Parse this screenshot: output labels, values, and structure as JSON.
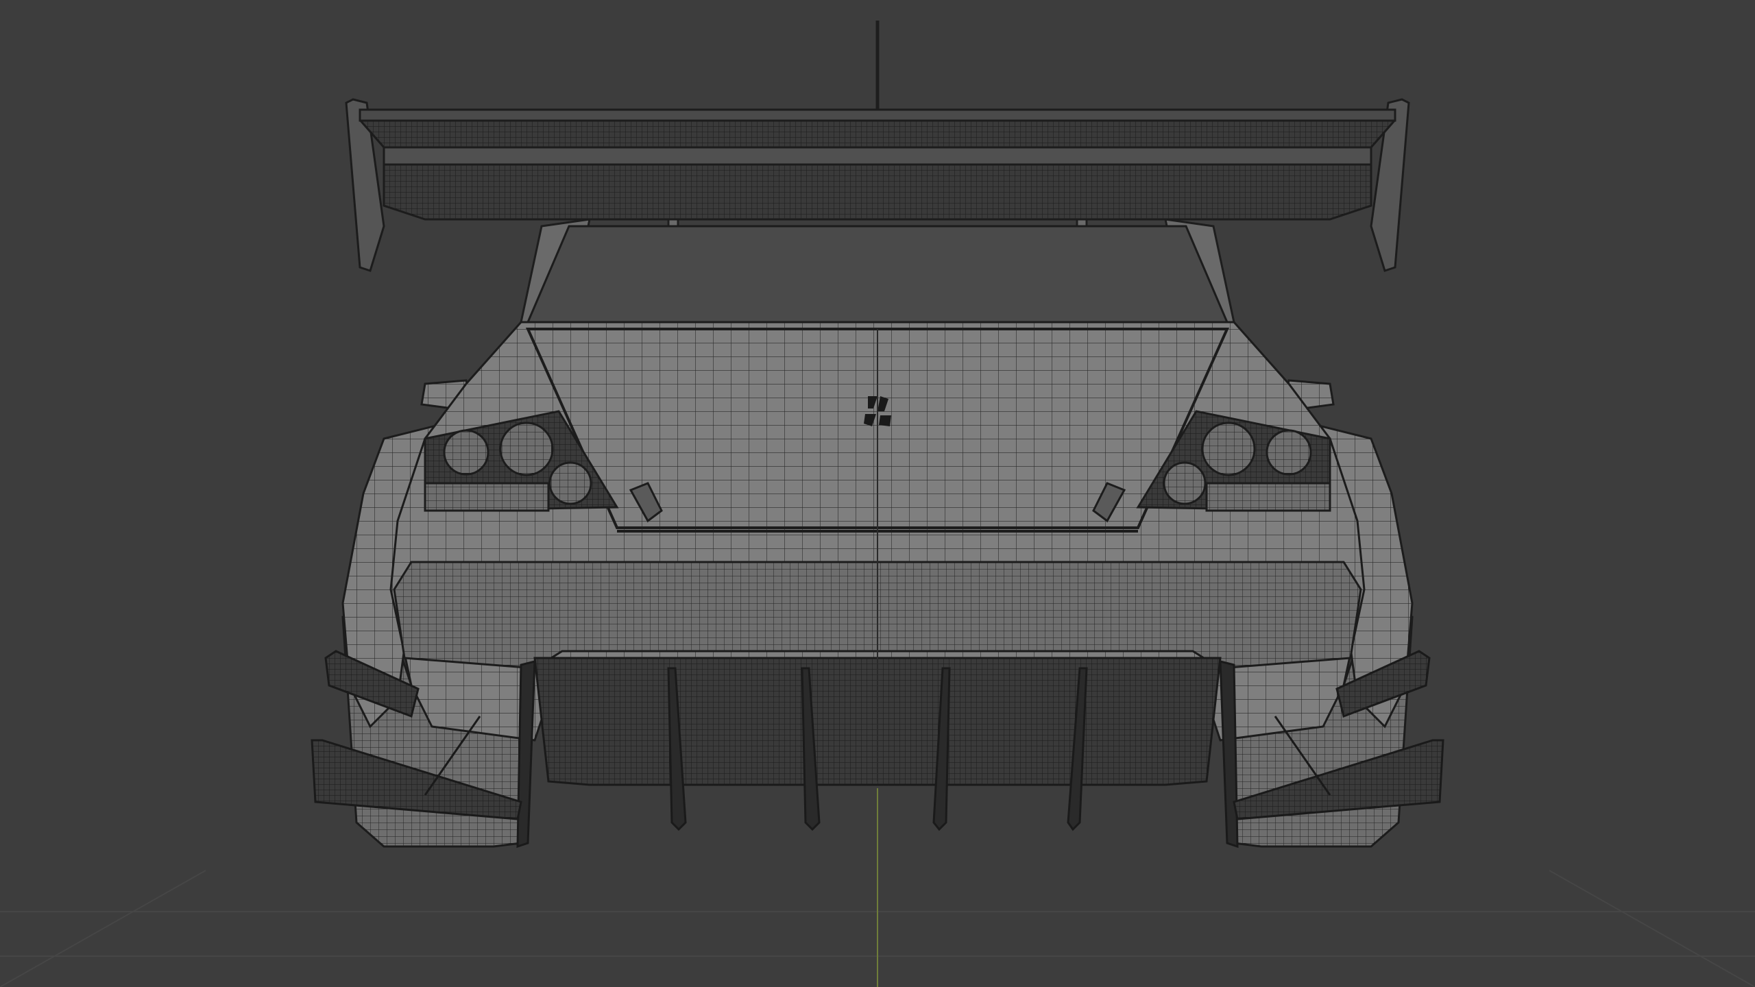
{
  "viewport": {
    "background_color": "#3d3d3d",
    "grid_line_color": "#474747",
    "vertical_axis_color": "#7a8a3a",
    "mesh_fill_color": "#808080",
    "mesh_dark_color": "#2f2f2f",
    "wire_color": "#1e1e1e",
    "shading_mode": "wireframe-on-solid"
  },
  "model": {
    "view": "rear-orthographic",
    "emblem_icon": "mitsubishi-logo-icon"
  }
}
